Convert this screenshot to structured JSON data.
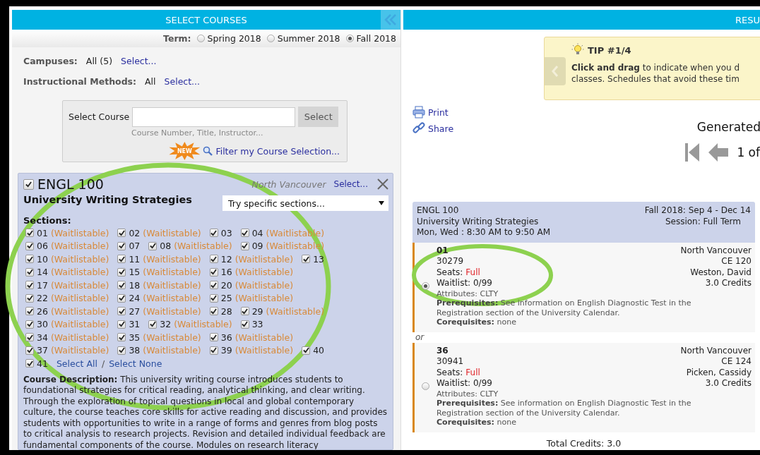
{
  "left_panel": {
    "title": "SELECT COURSES",
    "term": {
      "label": "Term:",
      "options": [
        {
          "label": "Spring 2018",
          "selected": false
        },
        {
          "label": "Summer 2018",
          "selected": false
        },
        {
          "label": "Fall 2018",
          "selected": true
        }
      ]
    },
    "filters": [
      {
        "label": "Campuses:",
        "value": "All (5)",
        "link": "Select..."
      },
      {
        "label": "Instructional Methods:",
        "value": "All",
        "link": "Select..."
      }
    ],
    "course_search": {
      "label": "Select Course",
      "button": "Select",
      "hint": "Course Number, Title, Instructor...",
      "badge": "NEW",
      "filter_link": "Filter my Course Selection..."
    },
    "course": {
      "checked": true,
      "code": "ENGL 100",
      "campus": "North Vancouver",
      "campus_link": "Select...",
      "title": "University Writing Strategies",
      "sections_dropdown": "Try specific sections...",
      "sections_label": "Sections:",
      "section_rows": [
        [
          {
            "number": "01",
            "status": "(Waitlistable)",
            "checked": true
          },
          {
            "number": "02",
            "status": "(Waitlistable)",
            "checked": true
          },
          {
            "number": "03",
            "checked": true
          },
          {
            "number": "04",
            "status": "(Waitlistable)",
            "checked": true
          }
        ],
        [
          {
            "number": "06",
            "status": "(Waitlistable)",
            "checked": true
          },
          {
            "number": "07",
            "checked": true
          },
          {
            "number": "08",
            "status": "(Waitlistable)",
            "checked": true
          },
          {
            "number": "09",
            "status": "(Waitlistable)",
            "checked": true
          }
        ],
        [
          {
            "number": "10",
            "status": "(Waitlistable)",
            "checked": true
          },
          {
            "number": "11",
            "status": "(Waitlistable)",
            "checked": true
          },
          {
            "number": "12",
            "status": "(Waitlistable)",
            "checked": true
          },
          {
            "number": "13",
            "checked": true
          }
        ],
        [
          {
            "number": "14",
            "status": "(Waitlistable)",
            "checked": true
          },
          {
            "number": "15",
            "status": "(Waitlistable)",
            "checked": true
          },
          {
            "number": "16",
            "status": "(Waitlistable)",
            "checked": true
          }
        ],
        [
          {
            "number": "17",
            "status": "(Waitlistable)",
            "checked": true
          },
          {
            "number": "18",
            "status": "(Waitlistable)",
            "checked": true
          },
          {
            "number": "20",
            "status": "(Waitlistable)",
            "checked": true
          }
        ],
        [
          {
            "number": "22",
            "status": "(Waitlistable)",
            "checked": true
          },
          {
            "number": "24",
            "status": "(Waitlistable)",
            "checked": true
          },
          {
            "number": "25",
            "status": "(Waitlistable)",
            "checked": true
          }
        ],
        [
          {
            "number": "26",
            "status": "(Waitlistable)",
            "checked": true
          },
          {
            "number": "27",
            "status": "(Waitlistable)",
            "checked": true
          },
          {
            "number": "28",
            "checked": true
          },
          {
            "number": "29",
            "status": "(Waitlistable)",
            "checked": true
          }
        ],
        [
          {
            "number": "30",
            "status": "(Waitlistable)",
            "checked": true
          },
          {
            "number": "31",
            "checked": true
          },
          {
            "number": "32",
            "status": "(Waitlistable)",
            "checked": true
          },
          {
            "number": "33",
            "checked": true
          }
        ],
        [
          {
            "number": "34",
            "status": "(Waitlistable)",
            "checked": true
          },
          {
            "number": "35",
            "status": "(Waitlistable)",
            "checked": true
          },
          {
            "number": "36",
            "status": "(Waitlistable)",
            "checked": true
          }
        ],
        [
          {
            "number": "37",
            "status": "(Waitlistable)",
            "checked": true
          },
          {
            "number": "38",
            "status": "(Waitlistable)",
            "checked": true
          },
          {
            "number": "39",
            "status": "(Waitlistable)",
            "checked": true
          },
          {
            "number": "40",
            "checked": true
          }
        ],
        [
          {
            "number": "41",
            "checked": true
          }
        ]
      ],
      "select_all": "Select All",
      "separator": "/",
      "select_none": "Select None",
      "description": "**Course Description:** This university writing course introduces students to foundational strategies for critical reading, analytical thinking, and clear writing. Through the exploration of topical questions in local and global contemporary culture, the course teaches core skills for active reading and discussion, and provides students with opportunities to write in a range of forms and genres from blog posts to critical analysis to research projects. Revision and detailed individual feedback are fundamental components of the course. Modules on research literacy"
    }
  },
  "right_panel": {
    "title": "RESU",
    "tip": {
      "title": "TIP #1/4",
      "lines": [
        "**Click and drag** to indicate when you d",
        "classes. Schedules that avoid these tim"
      ]
    },
    "links": [
      "Print",
      "Share"
    ],
    "generated": "Generated",
    "pager": "1 of",
    "schedule": {
      "code": "ENGL 100",
      "title": "University Writing Strategies",
      "times": "Mon, Wed : 8:30 AM to 9:50 AM",
      "term": "Fall 2018: Sep 4 - Dec 14",
      "session": "Session: Full Term",
      "options": [
        {
          "section": "01",
          "crn": "30279",
          "seats_label": "Seats:",
          "seats": "Full",
          "waitlist": "Waitlist: 0/99",
          "attributes": "Attributes: CLTY",
          "prerequisites": "**Prerequisites:** See information on English Diagnostic Test in the Registration section of the University Calendar.",
          "corequisites": "**Corequisites:** none",
          "campus": "North Vancouver",
          "room": "CE 120",
          "instructor": "Weston, David",
          "credits": "3.0 Credits",
          "selected": true
        },
        {
          "section": "36",
          "crn": "30941",
          "seats_label": "Seats:",
          "seats": "Full",
          "waitlist": "Waitlist: 0/99",
          "attributes": "Attributes: CLTY",
          "prerequisites": "**Prerequisites:** See information on English Diagnostic Test in the Registration section of the University Calendar.",
          "corequisites": "**Corequisites:** none",
          "campus": "North Vancouver",
          "room": "CE 124",
          "instructor": "Picken, Cassidy",
          "credits": "3.0 Credits",
          "selected": false
        }
      ],
      "separator": "or",
      "total": "Total Credits: 3.0"
    }
  }
}
